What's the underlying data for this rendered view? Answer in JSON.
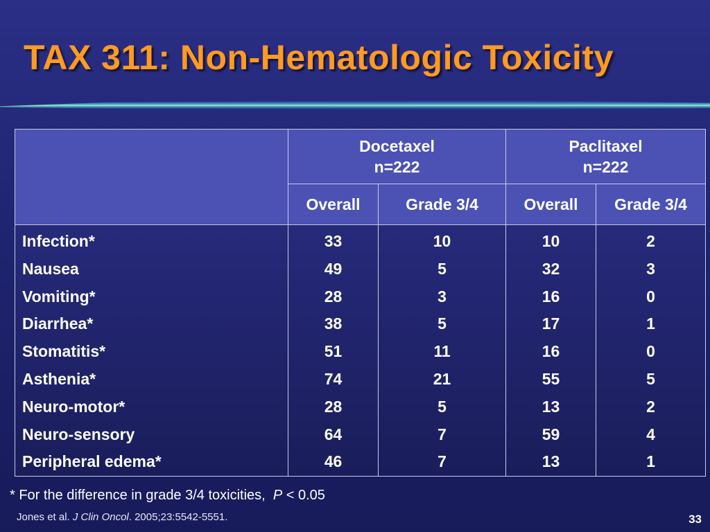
{
  "slide": {
    "title": "TAX 311: Non-Hematologic Toxicity",
    "page_number": "33"
  },
  "table": {
    "groups": [
      {
        "name": "Docetaxel",
        "n": "n=222"
      },
      {
        "name": "Paclitaxel",
        "n": "n=222"
      }
    ],
    "subheaders": [
      "Overall",
      "Grade 3/4",
      "Overall",
      "Grade 3/4"
    ],
    "rows": [
      {
        "label": "Infection*",
        "values": [
          "33",
          "10",
          "10",
          "2"
        ]
      },
      {
        "label": "Nausea",
        "values": [
          "49",
          "5",
          "32",
          "3"
        ]
      },
      {
        "label": "Vomiting*",
        "values": [
          "28",
          "3",
          "16",
          "0"
        ]
      },
      {
        "label": "Diarrhea*",
        "values": [
          "38",
          "5",
          "17",
          "1"
        ]
      },
      {
        "label": "Stomatitis*",
        "values": [
          "51",
          "11",
          "16",
          "0"
        ]
      },
      {
        "label": "Asthenia*",
        "values": [
          "74",
          "21",
          "55",
          "5"
        ]
      },
      {
        "label": "Neuro-motor*",
        "values": [
          "28",
          "5",
          "13",
          "2"
        ]
      },
      {
        "label": "Neuro-sensory",
        "values": [
          "64",
          "7",
          "59",
          "4"
        ]
      },
      {
        "label": "Peripheral edema*",
        "values": [
          "46",
          "7",
          "13",
          "1"
        ]
      }
    ]
  },
  "footnote": {
    "text": "* For the difference in grade 3/4 toxicities,",
    "p_symbol": "P",
    "p_value": "< 0.05"
  },
  "citation": {
    "authors": "Jones et al.",
    "journal": "J Clin Oncol",
    "details": ". 2005;23:5542-5551."
  },
  "colors": {
    "title": "#ff9a22",
    "header_fill": "#4b52b4",
    "background": "#1f2470"
  }
}
